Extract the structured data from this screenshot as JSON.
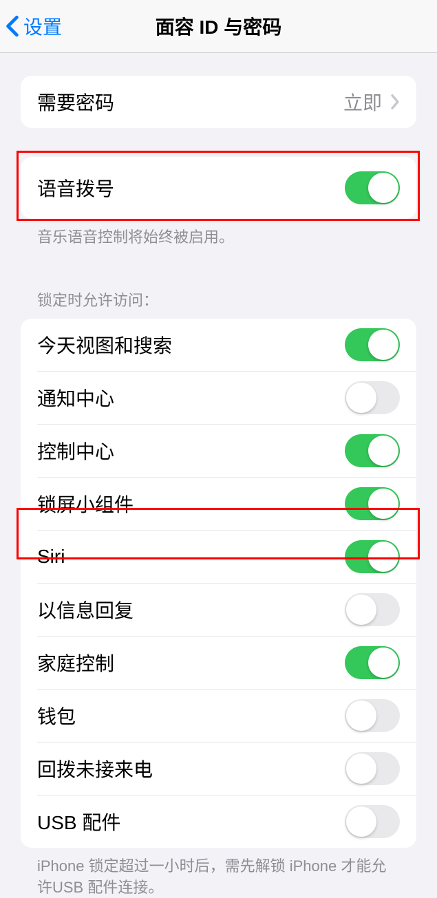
{
  "header": {
    "back_label": "设置",
    "title": "面容 ID 与密码"
  },
  "group1": {
    "require_passcode": {
      "label": "需要密码",
      "value": "立即"
    }
  },
  "group2": {
    "voice_dial": {
      "label": "语音拨号",
      "on": true
    },
    "footer": "音乐语音控制将始终被启用。"
  },
  "group3": {
    "header": "锁定时允许访问：",
    "items": [
      {
        "label": "今天视图和搜索",
        "on": true
      },
      {
        "label": "通知中心",
        "on": false
      },
      {
        "label": "控制中心",
        "on": true
      },
      {
        "label": "锁屏小组件",
        "on": true
      },
      {
        "label": "Siri",
        "on": true
      },
      {
        "label": "以信息回复",
        "on": false
      },
      {
        "label": "家庭控制",
        "on": true
      },
      {
        "label": "钱包",
        "on": false
      },
      {
        "label": "回拨未接来电",
        "on": false
      },
      {
        "label": "USB 配件",
        "on": false
      }
    ],
    "footer": "iPhone 锁定超过一小时后，需先解锁 iPhone 才能允许USB 配件连接。"
  }
}
